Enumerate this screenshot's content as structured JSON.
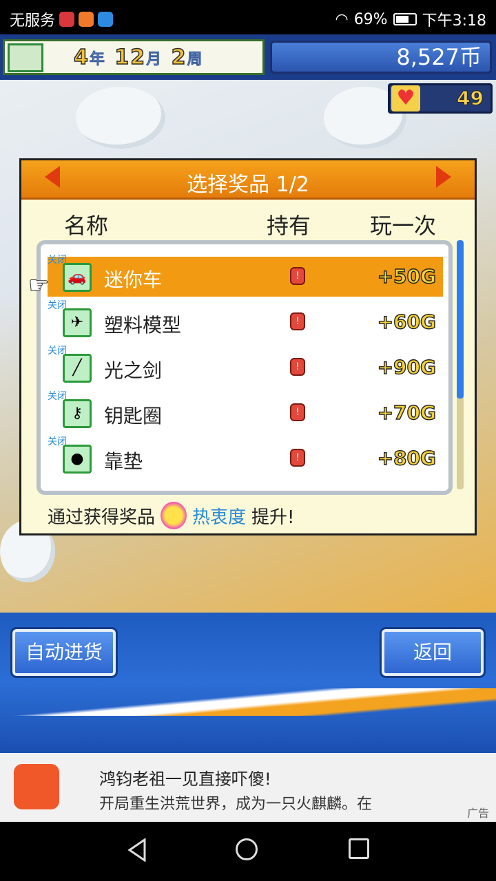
{
  "status_bar": {
    "carrier": "无服务",
    "battery": "69%",
    "time": "下午3:18",
    "icon_names": [
      "notification-icon",
      "video-icon",
      "browser-icon",
      "wifi-icon",
      "battery-icon"
    ]
  },
  "game_header": {
    "year_num": "4",
    "year_unit": "年",
    "month_num": "12",
    "month_unit": "月",
    "week_num": "2",
    "week_unit": "周",
    "money": "8,527币",
    "popularity": "49"
  },
  "dialog": {
    "title": "选择奖品 1/2",
    "columns": {
      "name": "名称",
      "owned": "持有",
      "play": "玩一次"
    },
    "items": [
      {
        "badge": "关闭",
        "icon": "car-icon",
        "name": "迷你车",
        "owned": "!",
        "price": "+50G",
        "selected": true
      },
      {
        "badge": "关闭",
        "icon": "plane-model-icon",
        "name": "塑料模型",
        "owned": "!",
        "price": "+60G"
      },
      {
        "badge": "关闭",
        "icon": "light-sword-icon",
        "name": "光之剑",
        "owned": "!",
        "price": "+90G"
      },
      {
        "badge": "关闭",
        "icon": "keyring-icon",
        "name": "钥匙圈",
        "owned": "!",
        "price": "+70G"
      },
      {
        "badge": "关闭",
        "icon": "cushion-icon",
        "name": "靠垫",
        "owned": "!",
        "price": "+80G"
      }
    ],
    "footer_prefix": "通过获得奖品",
    "footer_highlight": "热衷度",
    "footer_suffix": "提升!"
  },
  "buttons": {
    "auto_stock": "自动进货",
    "back": "返回"
  },
  "ad": {
    "title": "鸿钧老祖一见直接吓傻!",
    "description": "开局重生洪荒世界，成为一只火麒麟。在",
    "tag": "广告"
  },
  "colors": {
    "accent_orange": "#f29a12",
    "game_blue": "#2c6ed6",
    "highlight_blue": "#2a8bd8"
  }
}
